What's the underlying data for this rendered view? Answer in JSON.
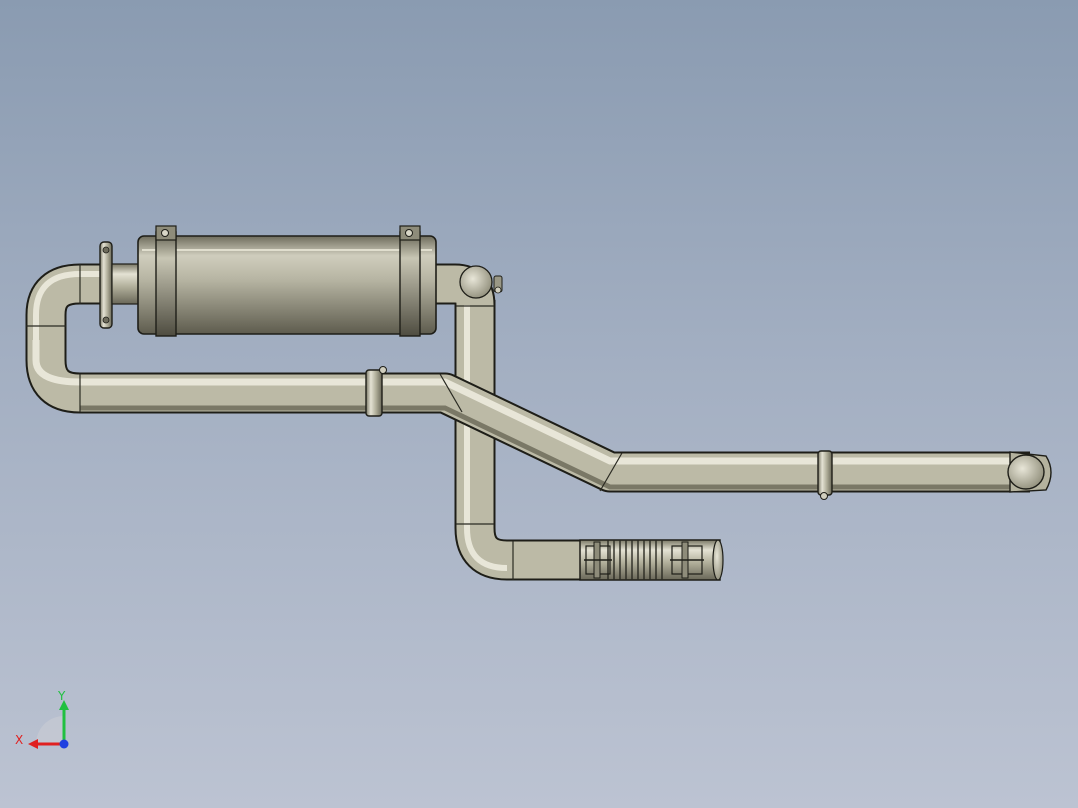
{
  "triad": {
    "x_label": "X",
    "y_label": "Y"
  },
  "colors": {
    "background_top": "#8a9bb1",
    "background_bottom": "#bcc3d2",
    "metal": "#b8b6a2",
    "metal_highlight": "#e6e4d6",
    "metal_shadow": "#6e6c5c",
    "outline": "#1e1e18",
    "axis_x": "#e02020",
    "axis_y": "#20c040",
    "axis_z": "#2040e0"
  },
  "parts": [
    "muffler",
    "inlet-elbow",
    "outlet-elbow",
    "main-pipe",
    "tail-pipe",
    "vertical-pipe",
    "flex-coupling",
    "clamps"
  ]
}
